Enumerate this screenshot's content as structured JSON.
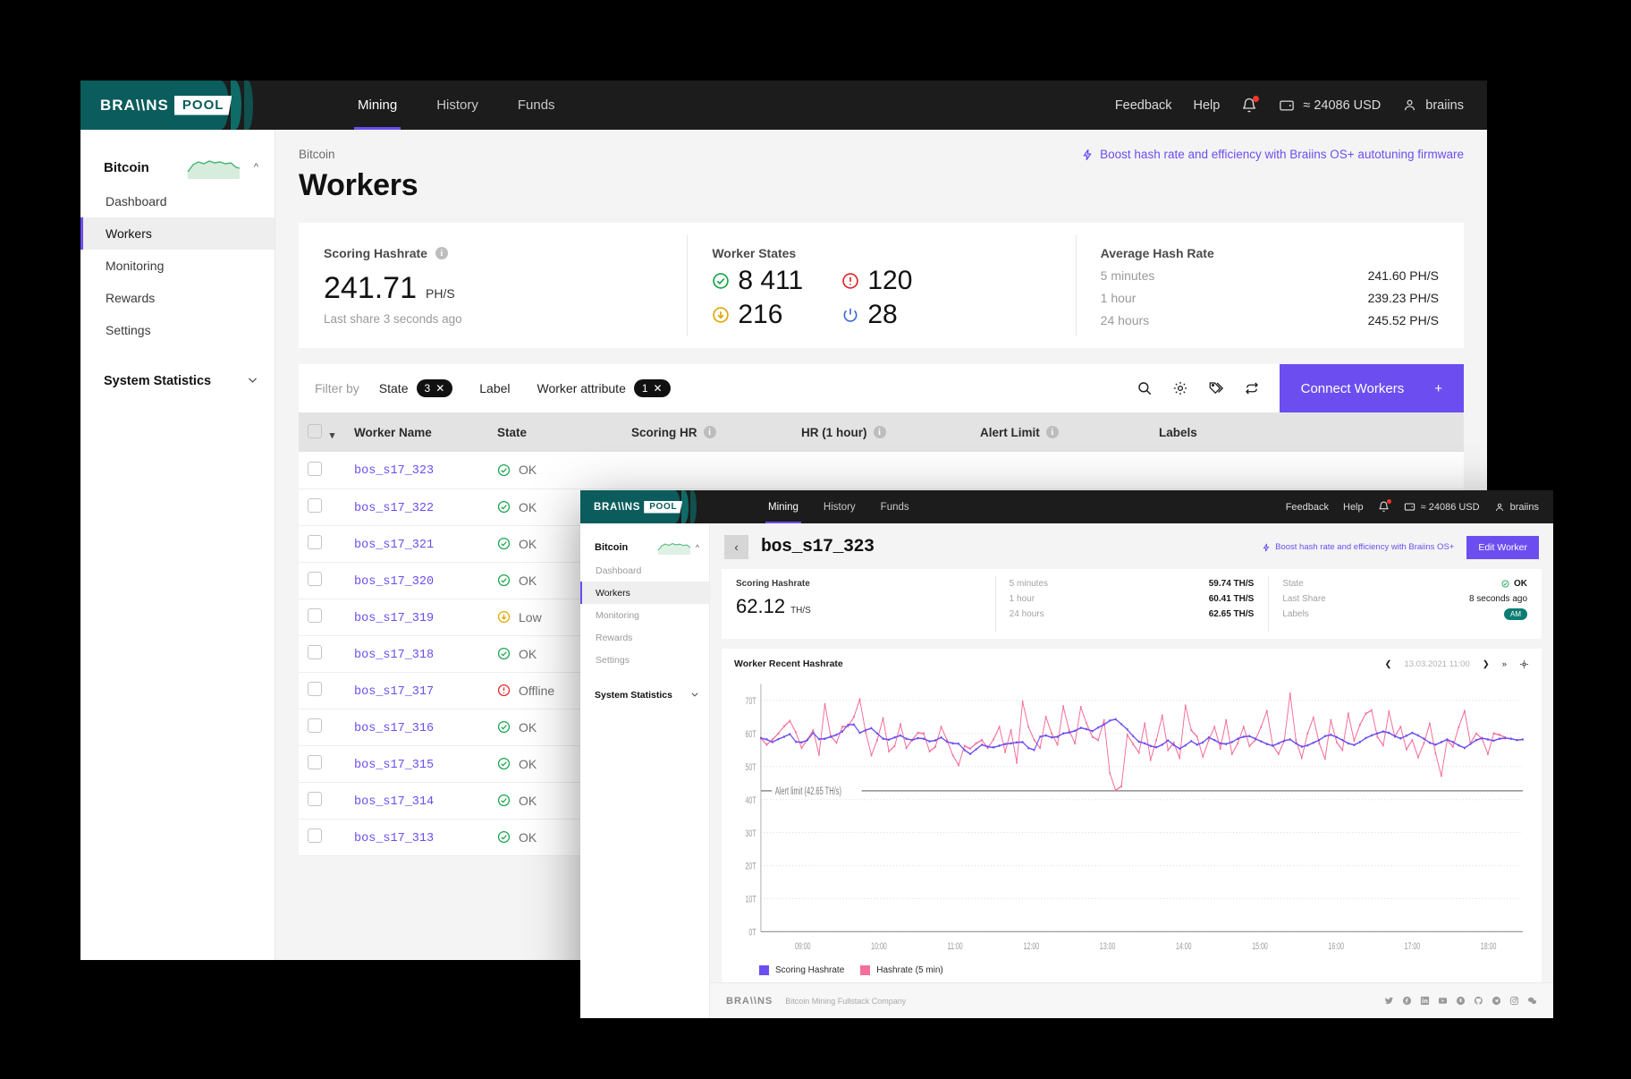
{
  "back": {
    "brand": {
      "braiins": "BRA\\\\NS",
      "pool": "POOL"
    },
    "nav": [
      {
        "label": "Mining",
        "active": true
      },
      {
        "label": "History",
        "active": false
      },
      {
        "label": "Funds",
        "active": false
      }
    ],
    "topbar_right": {
      "feedback": "Feedback",
      "help": "Help",
      "wallet": "≈ 24086 USD",
      "user": "braiins"
    },
    "sidebar": {
      "coin": "Bitcoin",
      "items": [
        {
          "label": "Dashboard",
          "active": false
        },
        {
          "label": "Workers",
          "active": true
        },
        {
          "label": "Monitoring",
          "active": false
        },
        {
          "label": "Rewards",
          "active": false
        },
        {
          "label": "Settings",
          "active": false
        }
      ],
      "system_statistics": "System Statistics"
    },
    "breadcrumb": "Bitcoin",
    "page_title": "Workers",
    "boost_banner": "Boost hash rate and efficiency with Braiins OS+ autotuning firmware",
    "cards": {
      "scoring": {
        "title": "Scoring Hashrate",
        "value": "241.71",
        "unit": "PH/S",
        "note": "Last share 3 seconds ago"
      },
      "worker_states": {
        "title": "Worker States",
        "ok": "8 411",
        "low": "216",
        "offline": "120",
        "disabled": "28"
      },
      "average": {
        "title": "Average Hash Rate",
        "rows": [
          {
            "label": "5 minutes",
            "value": "241.60 PH/S"
          },
          {
            "label": "1 hour",
            "value": "239.23 PH/S"
          },
          {
            "label": "24 hours",
            "value": "245.52 PH/S"
          }
        ]
      }
    },
    "filter": {
      "label": "Filter by",
      "state": "State",
      "state_count": "3",
      "label_chip": "Label",
      "attribute": "Worker attribute",
      "attribute_count": "1",
      "connect_workers": "Connect Workers"
    },
    "table": {
      "columns": [
        "Worker Name",
        "State",
        "Scoring HR",
        "HR (1 hour)",
        "Alert Limit",
        "Labels"
      ],
      "rows": [
        {
          "name": "bos_s17_323",
          "state": "OK",
          "state_kind": "ok"
        },
        {
          "name": "bos_s17_322",
          "state": "OK",
          "state_kind": "ok"
        },
        {
          "name": "bos_s17_321",
          "state": "OK",
          "state_kind": "ok"
        },
        {
          "name": "bos_s17_320",
          "state": "OK",
          "state_kind": "ok"
        },
        {
          "name": "bos_s17_319",
          "state": "Low",
          "state_kind": "low"
        },
        {
          "name": "bos_s17_318",
          "state": "OK",
          "state_kind": "ok"
        },
        {
          "name": "bos_s17_317",
          "state": "Offline",
          "state_kind": "offline"
        },
        {
          "name": "bos_s17_316",
          "state": "OK",
          "state_kind": "ok"
        },
        {
          "name": "bos_s17_315",
          "state": "OK",
          "state_kind": "ok"
        },
        {
          "name": "bos_s17_314",
          "state": "OK",
          "state_kind": "ok"
        },
        {
          "name": "bos_s17_313",
          "state": "OK",
          "state_kind": "ok"
        }
      ]
    }
  },
  "front": {
    "brand": {
      "braiins": "BRA\\\\NS",
      "pool": "POOL"
    },
    "nav": [
      {
        "label": "Mining",
        "active": true
      },
      {
        "label": "History",
        "active": false
      },
      {
        "label": "Funds",
        "active": false
      }
    ],
    "topbar_right": {
      "feedback": "Feedback",
      "help": "Help",
      "wallet": "≈ 24086 USD",
      "user": "braiins"
    },
    "sidebar": {
      "coin": "Bitcoin",
      "items": [
        {
          "label": "Dashboard",
          "active": false
        },
        {
          "label": "Workers",
          "active": true
        },
        {
          "label": "Monitoring",
          "active": false
        },
        {
          "label": "Rewards",
          "active": false
        },
        {
          "label": "Settings",
          "active": false
        }
      ],
      "system_statistics": "System Statistics"
    },
    "title": "bos_s17_323",
    "boost_banner": "Boost hash rate and efficiency with Braiins OS+",
    "edit_worker": "Edit Worker",
    "cards": {
      "scoring": {
        "title": "Scoring Hashrate",
        "value": "62.12",
        "unit": "TH/S"
      },
      "rates": [
        {
          "label": "5 minutes",
          "value": "59.74 TH/S"
        },
        {
          "label": "1 hour",
          "value": "60.41 TH/S"
        },
        {
          "label": "24 hours",
          "value": "62.65 TH/S"
        }
      ],
      "meta": [
        {
          "label": "State",
          "value": "OK"
        },
        {
          "label": "Last Share",
          "value": "8 seconds ago"
        },
        {
          "label": "Labels",
          "value": "AM"
        }
      ]
    },
    "chart_header": {
      "title": "Worker Recent Hashrate",
      "date": "13.03.2021 11:00"
    },
    "footer": {
      "logo": "BRA\\\\NS",
      "tagline": "Bitcoin Mining Fullstack Company"
    }
  },
  "colors": {
    "accent": "#6c4ef0",
    "teal": "#0b5c5c",
    "ok": "#15a34a",
    "low": "#e0a500",
    "offline": "#e02424",
    "disabled": "#3b6bdb",
    "scoring_line": "#6c4ef0",
    "hashrate_line": "#f47099"
  },
  "chart_data": {
    "type": "line",
    "title": "Worker Recent Hashrate",
    "xlabel": "",
    "ylabel": "",
    "ylim": [
      0,
      75
    ],
    "yticks": [
      "0T",
      "10T",
      "20T",
      "30T",
      "40T",
      "50T",
      "60T",
      "70T"
    ],
    "ytick_values": [
      0,
      10,
      20,
      30,
      40,
      50,
      60,
      70
    ],
    "xticks": [
      "09:00",
      "10:00",
      "11:00",
      "12:00",
      "13:00",
      "14:00",
      "15:00",
      "16:00",
      "17:00",
      "18:00"
    ],
    "grid": true,
    "legend_position": "bottom-left",
    "annotations": [
      {
        "text": "Alert limit (42.65 TH/s)",
        "y": 42.65,
        "type": "hline"
      }
    ],
    "series": [
      {
        "name": "Scoring Hashrate",
        "color": "#6c4ef0",
        "values": [
          58.6,
          58.2,
          57.4,
          58.3,
          59.0,
          59.8,
          57.5,
          57.3,
          58.0,
          60.2,
          58.3,
          58.4,
          59.0,
          59.6,
          60.6,
          62.6,
          62.7,
          60.2,
          61.0,
          61.6,
          60.0,
          58.4,
          58.1,
          58.8,
          59.4,
          58.4,
          58.0,
          58.6,
          58.4,
          57.6,
          57.9,
          58.8,
          57.5,
          57.0,
          56.9,
          55.0,
          53.8,
          55.2,
          56.6,
          56.0,
          55.8,
          56.3,
          56.8,
          57.0,
          57.3,
          57.4,
          55.6,
          55.0,
          59.0,
          59.4,
          58.8,
          59.0,
          60.0,
          60.3,
          60.8,
          61.7,
          61.3,
          60.7,
          61.8,
          62.7,
          63.9,
          64.3,
          62.8,
          61.2,
          59.2,
          57.5,
          57.0,
          56.2,
          55.8,
          56.6,
          57.9,
          56.5,
          55.4,
          56.4,
          57.7,
          56.6,
          57.3,
          58.8,
          58.0,
          57.0,
          56.8,
          57.4,
          58.4,
          59.0,
          59.2,
          58.4,
          57.6,
          56.8,
          56.3,
          57.0,
          57.8,
          58.2,
          57.0,
          56.0,
          56.4,
          57.2,
          58.0,
          59.2,
          59.6,
          58.9,
          58.0,
          57.0,
          56.5,
          57.4,
          58.6,
          59.4,
          60.0,
          60.6,
          60.2,
          59.2,
          58.5,
          59.3,
          60.2,
          59.4,
          58.4,
          57.2,
          56.6,
          57.4,
          58.2,
          57.4,
          56.4,
          55.6,
          56.8,
          58.0,
          58.6,
          58.2,
          57.8,
          58.4,
          58.6,
          58.4,
          58.0,
          58.2
        ]
      },
      {
        "name": "Hashrate (5 min)",
        "color": "#f47099",
        "values": [
          58.6,
          56.6,
          58.2,
          60.0,
          62.2,
          63.8,
          60.4,
          55.6,
          58.2,
          61.0,
          53.6,
          68.8,
          59.2,
          57.2,
          62.0,
          62.2,
          65.0,
          70.3,
          60.6,
          53.4,
          58.0,
          64.6,
          54.6,
          56.2,
          62.8,
          55.6,
          58.0,
          60.2,
          60.0,
          54.6,
          56.0,
          62.0,
          58.0,
          53.4,
          50.4,
          56.2,
          55.4,
          57.0,
          58.0,
          55.6,
          58.2,
          62.0,
          54.4,
          61.0,
          51.2,
          69.6,
          62.0,
          58.0,
          55.6,
          65.0,
          60.0,
          56.6,
          68.2,
          61.0,
          57.0,
          68.0,
          63.0,
          59.0,
          58.0,
          64.0,
          48.0,
          42.8,
          44.0,
          59.6,
          56.8,
          54.2,
          63.0,
          52.0,
          58.0,
          65.4,
          55.0,
          57.2,
          52.6,
          68.4,
          61.0,
          59.0,
          53.0,
          58.0,
          62.0,
          55.4,
          64.0,
          53.8,
          57.0,
          62.0,
          56.2,
          58.0,
          62.0,
          66.8,
          56.4,
          53.8,
          57.8,
          72.0,
          58.0,
          52.6,
          60.0,
          64.8,
          57.0,
          52.4,
          64.0,
          57.4,
          55.0,
          66.0,
          57.8,
          62.6,
          66.0,
          67.0,
          59.0,
          56.4,
          66.6,
          59.0,
          62.0,
          55.2,
          58.0,
          52.8,
          57.0,
          63.0,
          54.0,
          47.2,
          58.0,
          56.0,
          62.0,
          66.8,
          57.0,
          60.0,
          58.4,
          53.8,
          60.0,
          59.6,
          58.8
        ]
      }
    ]
  }
}
